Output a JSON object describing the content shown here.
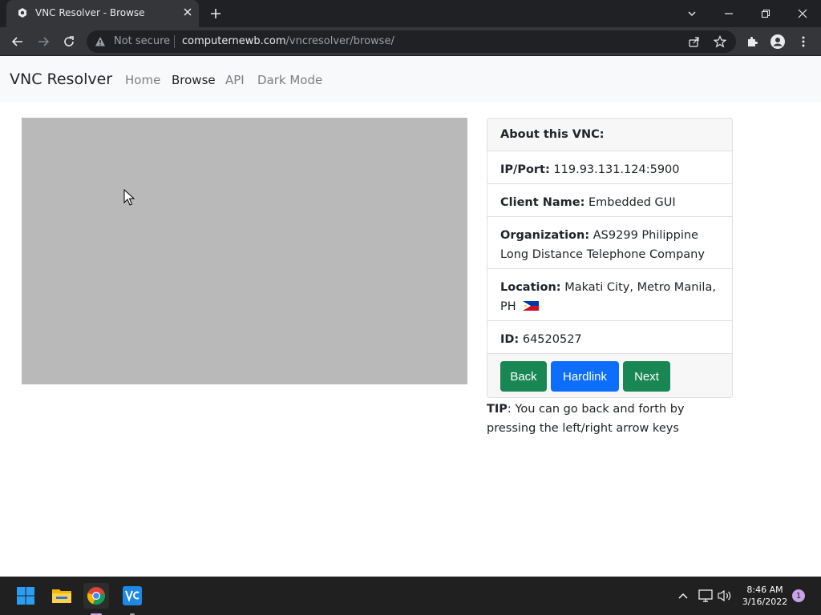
{
  "browser": {
    "tab_title": "VNC Resolver - Browse",
    "security_label": "Not secure",
    "url_host": "computernewb.com",
    "url_path": "/vncresolver/browse/"
  },
  "navbar": {
    "brand": "VNC Resolver",
    "links": [
      {
        "label": "Home"
      },
      {
        "label": "Browse"
      },
      {
        "label": "API"
      },
      {
        "label": "Dark Mode"
      }
    ]
  },
  "vnc_info": {
    "header": "About this VNC:",
    "ip_port_label": "IP/Port:",
    "ip_port": "119.93.131.124:5900",
    "client_name_label": "Client Name:",
    "client_name": "Embedded GUI",
    "organization_label": "Organization:",
    "organization": "AS9299 Philippine Long Distance Telephone Company",
    "location_label": "Location:",
    "location": "Makati City, Metro Manila, PH",
    "id_label": "ID:",
    "id": "64520527",
    "buttons": {
      "back": "Back",
      "hardlink": "Hardlink",
      "next": "Next"
    }
  },
  "tip": {
    "label": "TIP",
    "text": ": You can go back and forth by pressing the left/right arrow keys"
  },
  "taskbar": {
    "time": "8:46 AM",
    "date": "3/16/2022",
    "notification_count": "1"
  },
  "colors": {
    "btn_green": "#198754",
    "btn_blue": "#0d6efd",
    "vnc_screen": "#b9b9b9"
  }
}
